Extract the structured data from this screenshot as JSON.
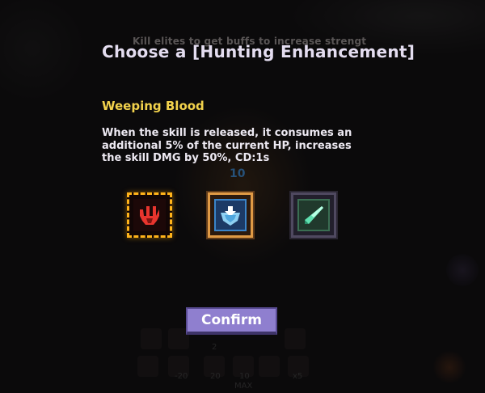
{
  "hint_text": "Kill elites to get buffs to increase strength",
  "title": "Choose a [Hunting Enhancement]",
  "selected": {
    "name": "Weeping Blood",
    "description": "When the skill is released, it consumes an additional 5% of the current HP, increases the skill DMG by 50%, CD:1s"
  },
  "options": [
    {
      "icon": "weeping-blood-icon",
      "selected": true
    },
    {
      "icon": "blue-shield-icon",
      "selected": false
    },
    {
      "icon": "green-blade-icon",
      "selected": false
    }
  ],
  "confirm_label": "Confirm",
  "background": {
    "center_number": "10",
    "hotbar_top_number": "2",
    "hotbar_numbers": [
      "-20",
      "20",
      "10",
      "x5"
    ],
    "max_label": "MAX"
  },
  "colors": {
    "name_yellow": "#f2d24c",
    "confirm_purple": "#8f7fcf",
    "selected_border": "#ffb31a"
  }
}
